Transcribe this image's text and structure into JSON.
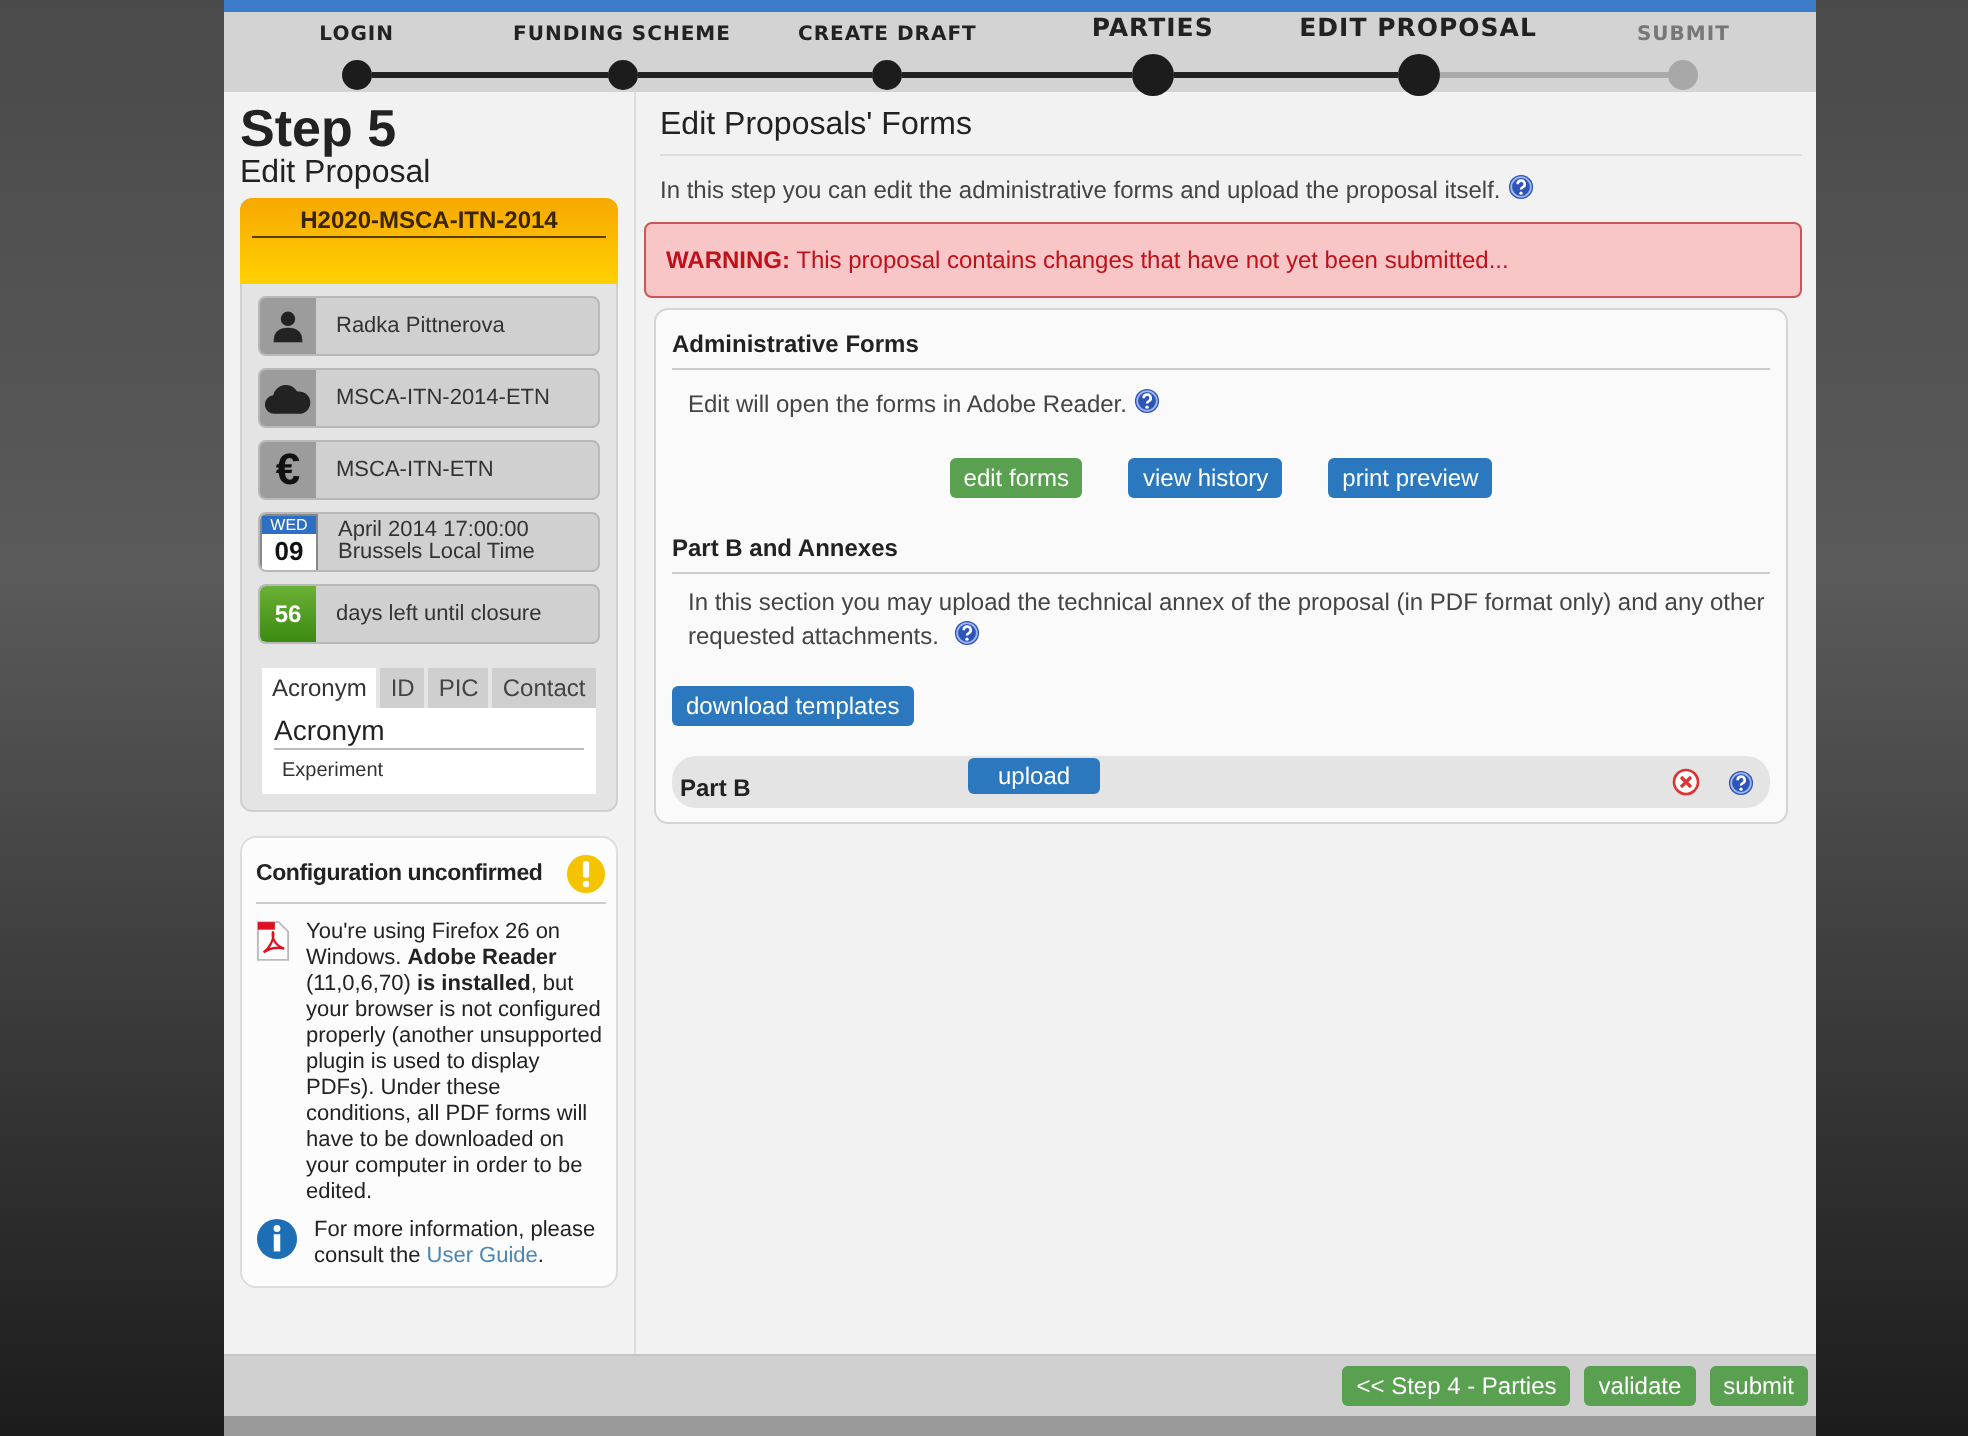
{
  "steps": [
    {
      "label": "LOGIN",
      "completed": true,
      "emphasized": false
    },
    {
      "label": "FUNDING SCHEME",
      "completed": true,
      "emphasized": false
    },
    {
      "label": "CREATE DRAFT",
      "completed": true,
      "emphasized": false
    },
    {
      "label": "PARTIES",
      "completed": true,
      "emphasized": true
    },
    {
      "label": "EDIT PROPOSAL",
      "completed": true,
      "emphasized": true
    },
    {
      "label": "SUBMIT",
      "completed": false,
      "emphasized": false
    }
  ],
  "sidebar": {
    "step_title": "Step 5",
    "step_subtitle": "Edit Proposal",
    "call_title": "H2020-MSCA-ITN-2014",
    "info_rows": [
      {
        "kind": "person",
        "text": "Radka Pittnerova"
      },
      {
        "kind": "cloud",
        "text": "MSCA-ITN-2014-ETN"
      },
      {
        "kind": "currency",
        "symbol": "€",
        "text": "MSCA-ITN-ETN"
      },
      {
        "kind": "date",
        "weekday": "WED",
        "day": "09",
        "text": "April 2014  17:00:00",
        "text2": "Brussels Local Time"
      },
      {
        "kind": "counter",
        "count": "56",
        "text": "days left until closure"
      }
    ],
    "tabs": [
      {
        "label": "Acronym",
        "selected": true
      },
      {
        "label": "ID",
        "selected": false
      },
      {
        "label": "PIC",
        "selected": false
      },
      {
        "label": "Contact",
        "selected": false
      }
    ],
    "tab_heading": "Acronym",
    "tab_value": "Experiment",
    "config": {
      "title": "Configuration unconfirmed",
      "message": "You're using Firefox 26 on Windows. **Adobe Reader** (11,0,6,70) **is installed**, but your browser is not configured properly (another unsupported plugin is used to display PDFs). Under these conditions, all PDF forms will have to be downloaded on your computer in order to be edited.",
      "info_text": "For more information, please consult the",
      "info_link": "User Guide",
      "info_end": "."
    }
  },
  "main": {
    "title": "Edit Proposals' Forms",
    "intro": "In this step you can edit the administrative forms and upload the proposal itself.",
    "warning_label": "WARNING:",
    "warning_text": "This proposal contains changes that have not yet been submitted...",
    "admin": {
      "heading": "Administrative Forms",
      "text": "Edit will open the forms in Adobe Reader.",
      "buttons": [
        {
          "label": "edit forms",
          "kind": "green"
        },
        {
          "label": "view history",
          "kind": "blue"
        },
        {
          "label": "print preview",
          "kind": "blue"
        }
      ]
    },
    "partb": {
      "heading": "Part B and Annexes",
      "text": "In this section you may upload the technical annex of the proposal (in PDF format only) and any other requested attachments.",
      "template_button": "download templates",
      "rows": [
        {
          "label": "Part B",
          "button": "upload"
        }
      ]
    }
  },
  "footer": {
    "buttons": [
      "<< Step 4 - Parties",
      "validate",
      "submit"
    ]
  }
}
